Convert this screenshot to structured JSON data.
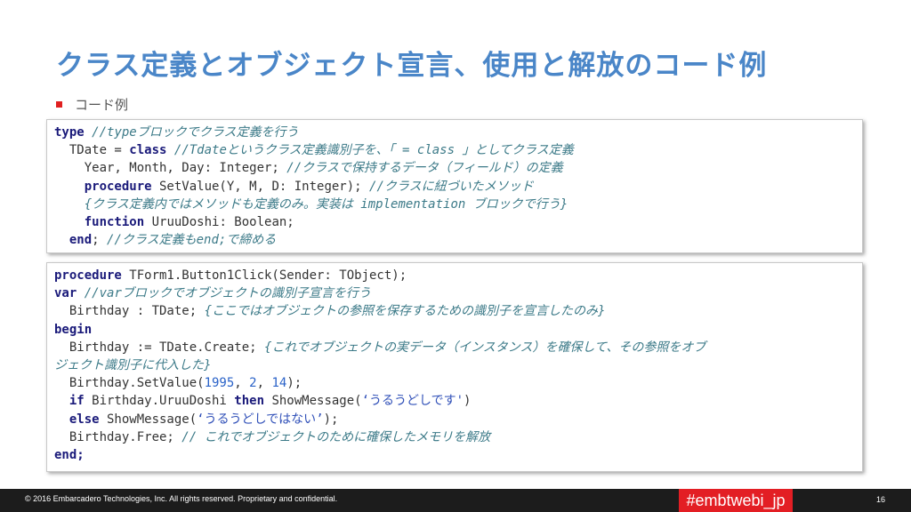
{
  "slide": {
    "title": "クラス定義とオブジェクト宣言、使用と解放のコード例",
    "bullet": "コード例"
  },
  "code_block_1": [
    [
      {
        "t": "kw",
        "v": "type"
      },
      {
        "t": "sp",
        "v": " "
      },
      {
        "t": "cm",
        "v": "//typeブロックでクラス定義を行う"
      }
    ],
    [
      {
        "t": "sp",
        "v": "  TDate = "
      },
      {
        "t": "kw",
        "v": "class"
      },
      {
        "t": "sp",
        "v": " "
      },
      {
        "t": "cm",
        "v": "//Tdateというクラス定義識別子を、「 = class 」としてクラス定義"
      }
    ],
    [
      {
        "t": "sp",
        "v": "    Year, Month, Day: Integer; "
      },
      {
        "t": "cm",
        "v": "//クラスで保持するデータ（フィールド）の定義"
      }
    ],
    [
      {
        "t": "sp",
        "v": "    "
      },
      {
        "t": "kw",
        "v": "procedure"
      },
      {
        "t": "sp",
        "v": " SetValue(Y, M, D: Integer); "
      },
      {
        "t": "cm",
        "v": "//クラスに紐づいたメソッド"
      }
    ],
    [
      {
        "t": "sp",
        "v": "    "
      },
      {
        "t": "cm",
        "v": "{クラス定義内ではメソッドも定義のみ。実装は implementation ブロックで行う}"
      }
    ],
    [
      {
        "t": "sp",
        "v": "    "
      },
      {
        "t": "kw",
        "v": "function"
      },
      {
        "t": "sp",
        "v": " UruuDoshi: Boolean;"
      }
    ],
    [
      {
        "t": "sp",
        "v": "  "
      },
      {
        "t": "kw",
        "v": "end"
      },
      {
        "t": "sp",
        "v": "; "
      },
      {
        "t": "cm",
        "v": "//クラス定義もend;で締める"
      }
    ]
  ],
  "code_block_2": [
    [
      {
        "t": "kw",
        "v": "procedure"
      },
      {
        "t": "sp",
        "v": " TForm1.Button1Click(Sender: TObject);"
      }
    ],
    [
      {
        "t": "kw",
        "v": "var"
      },
      {
        "t": "sp",
        "v": " "
      },
      {
        "t": "cm",
        "v": "//varブロックでオブジェクトの識別子宣言を行う"
      }
    ],
    [
      {
        "t": "sp",
        "v": "  Birthday : TDate; "
      },
      {
        "t": "cm",
        "v": "{ここではオブジェクトの参照を保存するための識別子を宣言したのみ}"
      }
    ],
    [
      {
        "t": "kw",
        "v": "begin"
      }
    ],
    [
      {
        "t": "sp",
        "v": "  Birthday := TDate.Create; "
      },
      {
        "t": "cm",
        "v": "{これでオブジェクトの実データ（インスタンス）を確保して、その参照をオブ"
      }
    ],
    [
      {
        "t": "cm",
        "v": "ジェクト識別子に代入した}"
      }
    ],
    [
      {
        "t": "sp",
        "v": "  Birthday.SetValue("
      },
      {
        "t": "num",
        "v": "1995"
      },
      {
        "t": "sp",
        "v": ", "
      },
      {
        "t": "num",
        "v": "2"
      },
      {
        "t": "sp",
        "v": ", "
      },
      {
        "t": "num",
        "v": "14"
      },
      {
        "t": "sp",
        "v": ");"
      }
    ],
    [
      {
        "t": "sp",
        "v": "  "
      },
      {
        "t": "kw",
        "v": "if"
      },
      {
        "t": "sp",
        "v": " Birthday.UruuDoshi "
      },
      {
        "t": "kw",
        "v": "then"
      },
      {
        "t": "sp",
        "v": " ShowMessage("
      },
      {
        "t": "str",
        "v": "‘うるうどしです'"
      },
      {
        "t": "sp",
        "v": ")"
      }
    ],
    [
      {
        "t": "sp",
        "v": "  "
      },
      {
        "t": "kw",
        "v": "else"
      },
      {
        "t": "sp",
        "v": " ShowMessage("
      },
      {
        "t": "str",
        "v": "‘うるうどしではない’"
      },
      {
        "t": "sp",
        "v": ");"
      }
    ],
    [
      {
        "t": "sp",
        "v": "  Birthday.Free; "
      },
      {
        "t": "cm",
        "v": "// これでオブジェクトのために確保したメモリを解放"
      }
    ],
    [
      {
        "t": "kw",
        "v": "end;"
      }
    ]
  ],
  "footer": {
    "copyright": "© 2016 Embarcadero Technologies, Inc. All rights reserved. Proprietary and confidential.",
    "hashtag": "#embtwebi_jp",
    "page_number": "16"
  },
  "colors": {
    "title": "#4a86c8",
    "bullet": "#e02020",
    "keyword": "#1a1a7a",
    "comment": "#3c7a88",
    "number": "#2a62c8",
    "footer_bg": "#1c1c1c",
    "hashtag_bg": "#e31e24"
  }
}
